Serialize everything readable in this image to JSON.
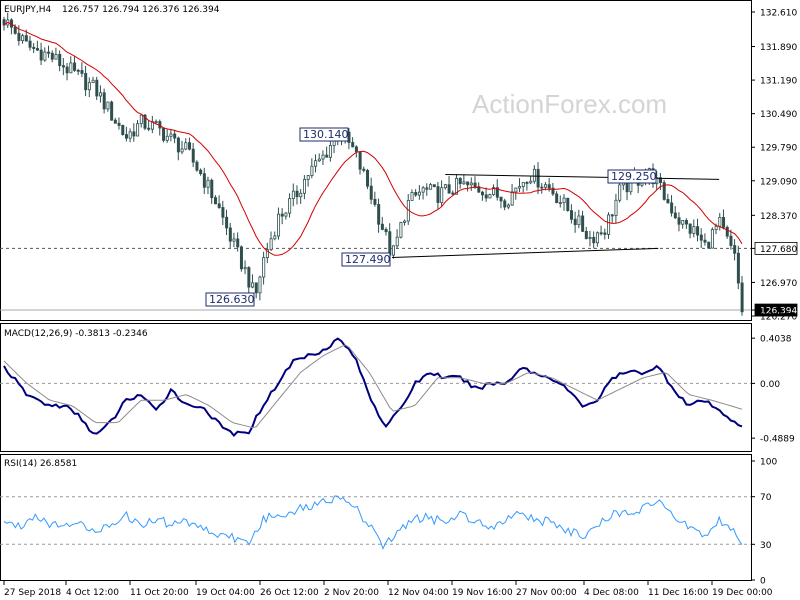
{
  "header": {
    "symbol": "EURJPY,H4",
    "ohlc": "126.757 126.794 126.376 126.394"
  },
  "watermark": "ActionForex.com",
  "colors": {
    "candle": "#2f4f4f",
    "ma": "#d40000",
    "macd": "#00007f",
    "signal": "#8c8c8c",
    "rsi": "#3399ff",
    "label_border": "#1f2d6b",
    "dashed": "#555555"
  },
  "price_axis": {
    "ticks": [
      "132.610",
      "131.890",
      "131.190",
      "130.490",
      "129.790",
      "129.090",
      "128.370",
      "127.680",
      "126.970",
      "126.394",
      "126.270"
    ],
    "current_label": "126.394",
    "marked_level": "127.680"
  },
  "annotations": [
    "130.140",
    "129.250",
    "127.490",
    "126.630"
  ],
  "macd_panel": {
    "title": "MACD(12,26,9) -0.3813 -0.2346",
    "ticks": [
      "0.4038",
      "0.00",
      "-0.4889"
    ]
  },
  "rsi_panel": {
    "title": "RSI(14) 26.8581",
    "ticks": [
      "100",
      "70",
      "30",
      "0"
    ]
  },
  "time_axis": [
    "27 Sep 2018",
    "4 Oct 12:00",
    "11 Oct 20:00",
    "19 Oct 04:00",
    "26 Oct 12:00",
    "2 Nov 20:00",
    "12 Nov 04:00",
    "19 Nov 16:00",
    "27 Nov 00:00",
    "4 Dec 08:00",
    "11 Dec 16:00",
    "19 Dec 00:00"
  ],
  "chart_data": [
    {
      "type": "candlestick",
      "title": "EURJPY,H4",
      "ylim": [
        126.27,
        132.61
      ],
      "series": [
        {
          "name": "EURJPY",
          "close_path": [
            [
              0,
              132.45
            ],
            [
              3,
              131.9
            ],
            [
              6,
              131.7
            ],
            [
              9,
              131.35
            ],
            [
              12,
              131.0
            ],
            [
              14,
              130.5
            ],
            [
              16,
              130.0
            ],
            [
              18,
              130.3
            ],
            [
              20,
              130.2
            ],
            [
              22,
              129.95
            ],
            [
              24,
              129.7
            ],
            [
              26,
              129.2
            ],
            [
              28,
              128.6
            ],
            [
              30,
              127.8
            ],
            [
              32,
              127.1
            ],
            [
              33,
              126.63
            ],
            [
              34,
              127.4
            ],
            [
              36,
              128.3
            ],
            [
              38,
              128.7
            ],
            [
              40,
              129.25
            ],
            [
              42,
              129.6
            ],
            [
              44,
              130.14
            ],
            [
              46,
              129.7
            ],
            [
              48,
              128.9
            ],
            [
              50,
              128.0
            ],
            [
              51,
              127.49
            ],
            [
              53,
              128.6
            ],
            [
              55,
              128.9
            ],
            [
              57,
              128.8
            ],
            [
              60,
              129.0
            ],
            [
              63,
              128.9
            ],
            [
              66,
              128.7
            ],
            [
              69,
              129.25
            ],
            [
              72,
              128.9
            ],
            [
              75,
              128.3
            ],
            [
              77,
              127.9
            ],
            [
              79,
              128.1
            ],
            [
              81,
              128.9
            ],
            [
              83,
              129.1
            ],
            [
              85,
              129.25
            ],
            [
              87,
              128.7
            ],
            [
              89,
              128.2
            ],
            [
              91,
              128.0
            ],
            [
              92,
              127.7
            ],
            [
              94,
              128.2
            ],
            [
              96,
              127.5
            ],
            [
              97,
              126.394
            ]
          ]
        }
      ],
      "annotations": [
        {
          "text": "130.140",
          "x": 44
        },
        {
          "text": "129.250",
          "x": 82
        },
        {
          "text": "127.490",
          "x": 51
        },
        {
          "text": "126.630",
          "x": 33
        }
      ],
      "horizontal_line": 127.68,
      "trendlines": [
        {
          "name": "upper",
          "from": [
            58,
            129.22
          ],
          "to": [
            94,
            129.12
          ]
        },
        {
          "name": "lower",
          "from": [
            51,
            127.49
          ],
          "to": [
            86,
            127.68
          ]
        }
      ]
    },
    {
      "type": "line",
      "title": "MACD(12,26,9) -0.3813 -0.2346",
      "ylim": [
        -0.55,
        0.45
      ],
      "series": [
        {
          "name": "MACD",
          "points": [
            [
              0,
              0.15
            ],
            [
              3,
              -0.1
            ],
            [
              6,
              -0.2
            ],
            [
              8,
              -0.2
            ],
            [
              10,
              -0.3
            ],
            [
              12,
              -0.47
            ],
            [
              14,
              -0.35
            ],
            [
              16,
              -0.15
            ],
            [
              18,
              -0.1
            ],
            [
              20,
              -0.25
            ],
            [
              22,
              -0.05
            ],
            [
              24,
              -0.2
            ],
            [
              26,
              -0.2
            ],
            [
              28,
              -0.35
            ],
            [
              30,
              -0.45
            ],
            [
              32,
              -0.45
            ],
            [
              34,
              -0.2
            ],
            [
              36,
              0.0
            ],
            [
              38,
              0.2
            ],
            [
              40,
              0.25
            ],
            [
              42,
              0.3
            ],
            [
              44,
              0.4
            ],
            [
              46,
              0.25
            ],
            [
              48,
              -0.1
            ],
            [
              50,
              -0.38
            ],
            [
              52,
              -0.25
            ],
            [
              54,
              0.0
            ],
            [
              56,
              0.1
            ],
            [
              58,
              0.05
            ],
            [
              60,
              0.05
            ],
            [
              62,
              -0.05
            ],
            [
              64,
              0.0
            ],
            [
              66,
              0.0
            ],
            [
              68,
              0.15
            ],
            [
              70,
              0.08
            ],
            [
              72,
              0.05
            ],
            [
              74,
              -0.05
            ],
            [
              76,
              -0.2
            ],
            [
              78,
              -0.15
            ],
            [
              80,
              0.05
            ],
            [
              82,
              0.1
            ],
            [
              84,
              0.1
            ],
            [
              86,
              0.15
            ],
            [
              88,
              -0.05
            ],
            [
              90,
              -0.2
            ],
            [
              92,
              -0.15
            ],
            [
              94,
              -0.25
            ],
            [
              97,
              -0.38
            ]
          ]
        },
        {
          "name": "Signal",
          "points": [
            [
              0,
              0.2
            ],
            [
              3,
              0.0
            ],
            [
              6,
              -0.15
            ],
            [
              9,
              -0.2
            ],
            [
              12,
              -0.35
            ],
            [
              15,
              -0.35
            ],
            [
              18,
              -0.15
            ],
            [
              21,
              -0.15
            ],
            [
              24,
              -0.1
            ],
            [
              27,
              -0.2
            ],
            [
              30,
              -0.35
            ],
            [
              33,
              -0.4
            ],
            [
              36,
              -0.15
            ],
            [
              39,
              0.1
            ],
            [
              42,
              0.25
            ],
            [
              45,
              0.35
            ],
            [
              48,
              0.1
            ],
            [
              51,
              -0.25
            ],
            [
              54,
              -0.2
            ],
            [
              57,
              0.05
            ],
            [
              60,
              0.05
            ],
            [
              63,
              0.0
            ],
            [
              66,
              0.0
            ],
            [
              69,
              0.1
            ],
            [
              72,
              0.05
            ],
            [
              75,
              -0.05
            ],
            [
              78,
              -0.15
            ],
            [
              81,
              -0.05
            ],
            [
              84,
              0.05
            ],
            [
              87,
              0.1
            ],
            [
              90,
              -0.1
            ],
            [
              93,
              -0.15
            ],
            [
              97,
              -0.23
            ]
          ]
        }
      ]
    },
    {
      "type": "line",
      "title": "RSI(14) 26.8581",
      "ylim": [
        0,
        100
      ],
      "reference_lines": [
        70,
        30
      ],
      "series": [
        {
          "name": "RSI",
          "points": [
            [
              0,
              50
            ],
            [
              2,
              45
            ],
            [
              4,
              55
            ],
            [
              6,
              48
            ],
            [
              8,
              44
            ],
            [
              10,
              52
            ],
            [
              12,
              37
            ],
            [
              14,
              48
            ],
            [
              16,
              55
            ],
            [
              18,
              45
            ],
            [
              20,
              52
            ],
            [
              22,
              46
            ],
            [
              24,
              50
            ],
            [
              26,
              44
            ],
            [
              28,
              38
            ],
            [
              30,
              36
            ],
            [
              32,
              30
            ],
            [
              34,
              50
            ],
            [
              36,
              55
            ],
            [
              38,
              58
            ],
            [
              40,
              62
            ],
            [
              42,
              65
            ],
            [
              44,
              72
            ],
            [
              46,
              62
            ],
            [
              48,
              45
            ],
            [
              50,
              28
            ],
            [
              52,
              42
            ],
            [
              54,
              52
            ],
            [
              56,
              52
            ],
            [
              58,
              48
            ],
            [
              60,
              56
            ],
            [
              62,
              50
            ],
            [
              64,
              45
            ],
            [
              66,
              52
            ],
            [
              68,
              58
            ],
            [
              70,
              48
            ],
            [
              72,
              50
            ],
            [
              74,
              42
            ],
            [
              76,
              36
            ],
            [
              78,
              45
            ],
            [
              80,
              55
            ],
            [
              82,
              58
            ],
            [
              84,
              60
            ],
            [
              86,
              65
            ],
            [
              88,
              52
            ],
            [
              90,
              45
            ],
            [
              92,
              38
            ],
            [
              94,
              50
            ],
            [
              96,
              40
            ],
            [
              97,
              27
            ]
          ]
        }
      ]
    }
  ]
}
